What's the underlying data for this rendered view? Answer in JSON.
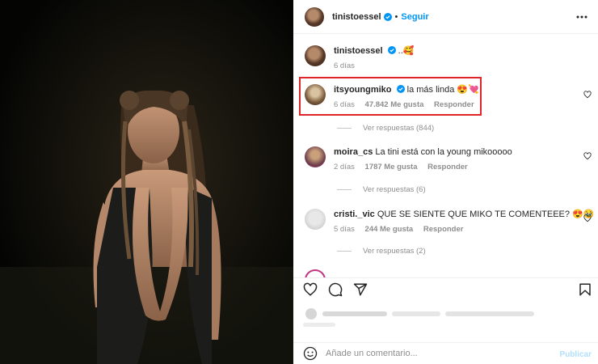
{
  "post": {
    "author": "tinistoessel",
    "follow_label": "Seguir",
    "caption_suffix": "..🥰",
    "caption_time": "6 días"
  },
  "comments": [
    {
      "user": "itsyoungmiko",
      "text": "la más linda 😍💘",
      "time": "6 días",
      "likes": "47.842 Me gusta",
      "reply_label": "Responder",
      "view_replies": "Ver respuestas (844)"
    },
    {
      "user": "moira_cs",
      "text": "La tini está con la young mikooooo",
      "time": "2 días",
      "likes": "1787 Me gusta",
      "reply_label": "Responder",
      "view_replies": "Ver respuestas (6)"
    },
    {
      "user": "cristi._vic",
      "text": "QUE SE SIENTE QUE MIKO TE COMENTEEE? 😍🥹",
      "time": "5 días",
      "likes": "244 Me gusta",
      "reply_label": "Responder",
      "view_replies": "Ver respuestas (2)"
    }
  ],
  "composer": {
    "placeholder": "Añade un comentario...",
    "publish_label": "Publicar"
  },
  "colors": {
    "verified": "#0095f6",
    "link": "#0095f6",
    "highlight": "#e0242a",
    "muted": "#8e8e8e"
  },
  "icons": [
    "heart-icon",
    "comment-icon",
    "share-icon",
    "bookmark-icon",
    "more-options-icon",
    "verified-icon",
    "emoji-icon"
  ]
}
